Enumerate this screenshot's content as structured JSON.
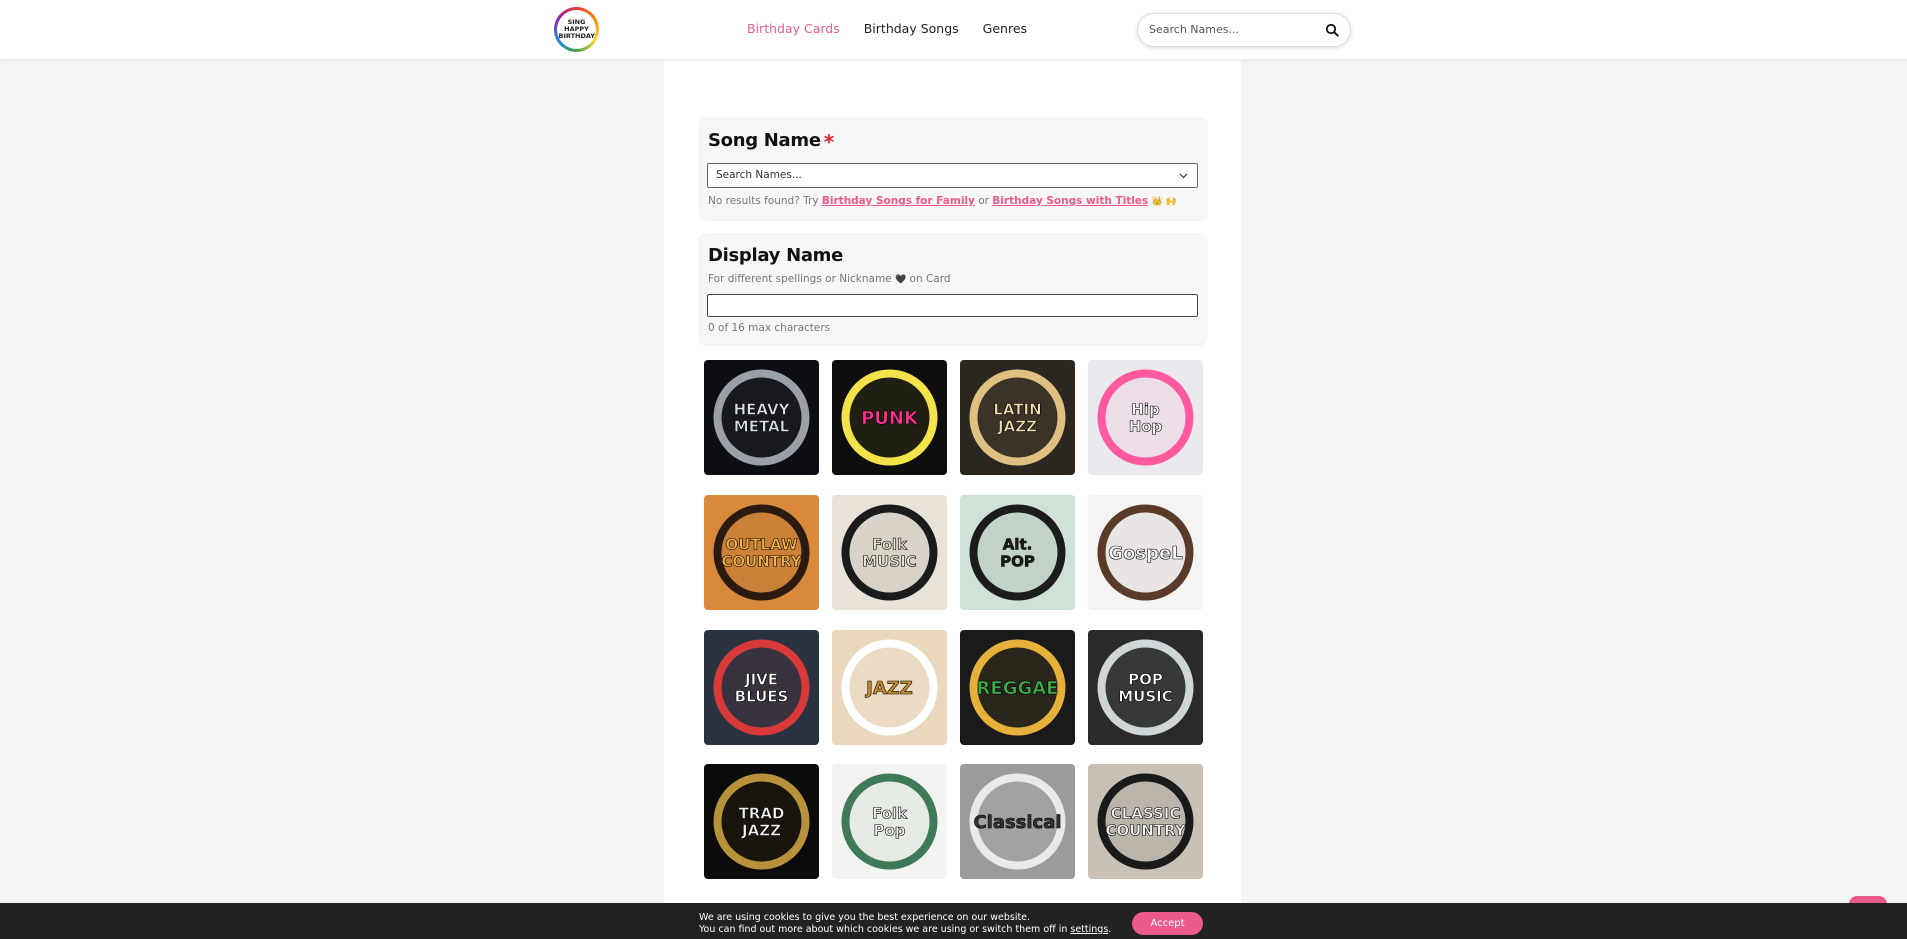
{
  "header": {
    "logo_text": "SING HAPPY BIRTHDAY",
    "nav": [
      {
        "label": "Birthday Cards",
        "active": true
      },
      {
        "label": "Birthday Songs",
        "active": false
      },
      {
        "label": "Genres",
        "active": false
      }
    ],
    "search_placeholder": "Search Names..."
  },
  "song_name": {
    "title": "Song Name",
    "required_mark": "*",
    "select_placeholder": "Search Names...",
    "hint_prefix": "No results found? Try",
    "hint_link1": "Birthday Songs for Family",
    "hint_or": "or",
    "hint_link2": "Birthday Songs with Titles",
    "hint_emoji": "👑 🙌"
  },
  "display_name": {
    "title": "Display Name",
    "hint_before": "For different spellings or Nickname",
    "hint_heart": "🖤",
    "hint_after": "on Card",
    "value": "",
    "counter": "0 of 16 max characters"
  },
  "genres": [
    {
      "id": "heavy-metal",
      "label": "HEAVY METAL",
      "bg": "#0d0d14",
      "ring": "#9aa0a8",
      "fg": "#d9dde2"
    },
    {
      "id": "punk",
      "label": "PUNK",
      "bg": "#0e0e0e",
      "ring": "#f2e34a",
      "fg": "#ff2f8f"
    },
    {
      "id": "latin-jazz",
      "label": "LATIN JAZZ",
      "bg": "#2c2621",
      "ring": "#e0c080",
      "fg": "#f0dcae"
    },
    {
      "id": "hip-hop",
      "label": "Hip Hop",
      "bg": "#e9e9ee",
      "ring": "#ff5aa0",
      "fg": "#ffffff"
    },
    {
      "id": "outlaw-country",
      "label": "OUTLAW COUNTRY",
      "bg": "#d8893a",
      "ring": "#2a1a10",
      "fg": "#f0b245"
    },
    {
      "id": "folk-music",
      "label": "Folk MUSIC",
      "bg": "#e8e2d8",
      "ring": "#1b1b1b",
      "fg": "#e8e0cf"
    },
    {
      "id": "alt-pop",
      "label": "Alt. POP",
      "bg": "#cfe2d6",
      "ring": "#1c1c1c",
      "fg": "#1c1c1c"
    },
    {
      "id": "gospel",
      "label": "GospeL",
      "bg": "#f4f4f4",
      "ring": "#5a3b2a",
      "fg": "#ffffff"
    },
    {
      "id": "jive-blues",
      "label": "JIVE BLUES",
      "bg": "#2b3340",
      "ring": "#d83a3a",
      "fg": "#ffffff"
    },
    {
      "id": "jazz",
      "label": "JAZZ",
      "bg": "#e9d8bd",
      "ring": "#ffffff",
      "fg": "#c58a2b"
    },
    {
      "id": "reggae",
      "label": "REGGAE",
      "bg": "#1a1a1a",
      "ring": "#e6b13a",
      "fg": "#3aa94a"
    },
    {
      "id": "pop-music",
      "label": "POP MUSIC",
      "bg": "#2a2a2a",
      "ring": "#cfd6d8",
      "fg": "#ffffff"
    },
    {
      "id": "trad-jazz",
      "label": "TRAD JAZZ",
      "bg": "#0b0b0b",
      "ring": "#b8923a",
      "fg": "#f2f2f2"
    },
    {
      "id": "folk-pop",
      "label": "Folk Pop",
      "bg": "#f3f3f1",
      "ring": "#3f7a58",
      "fg": "#f3f3f1"
    },
    {
      "id": "classical",
      "label": "Classical",
      "bg": "#9b9b9b",
      "ring": "#e9e9e9",
      "fg": "#333333"
    },
    {
      "id": "classic-country",
      "label": "CLASSIC COUNTRY",
      "bg": "#c9c1b6",
      "ring": "#1a1a1a",
      "fg": "#f2f2f2"
    }
  ],
  "cookie": {
    "line1": "We are using cookies to give you the best experience on our website.",
    "line2_prefix": "You can find out more about which cookies we are using or switch them off in",
    "line2_link": "settings",
    "line2_suffix": ".",
    "accept_label": "Accept"
  }
}
